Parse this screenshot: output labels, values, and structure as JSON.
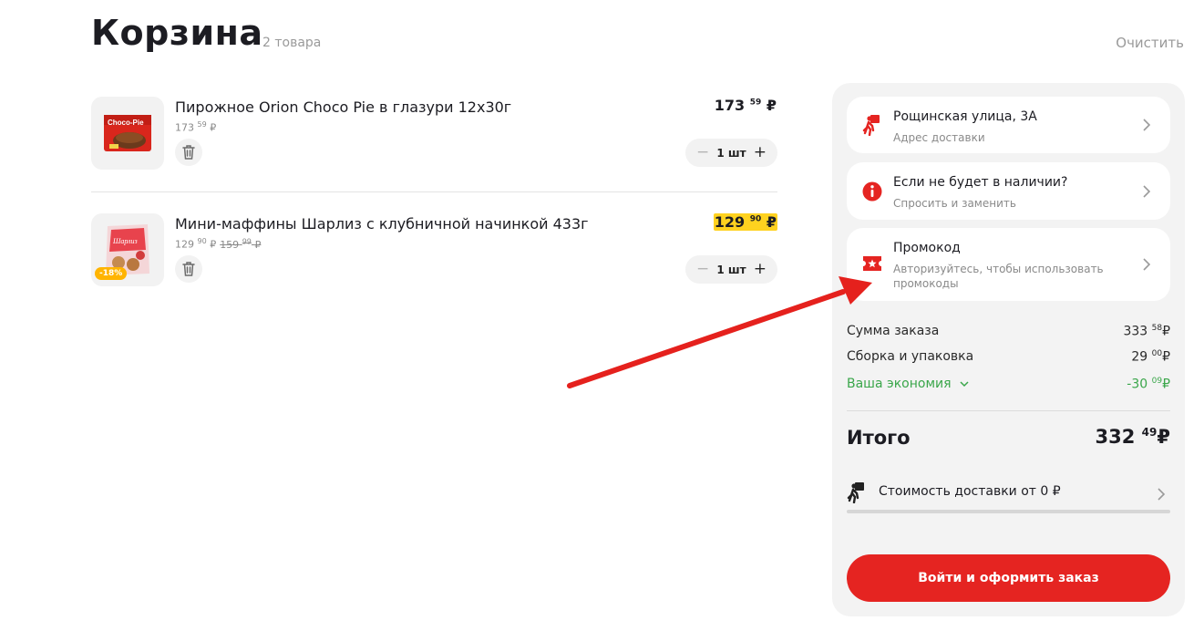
{
  "header": {
    "title": "Корзина",
    "count": "2 товара",
    "clear_label": "Очистить"
  },
  "cart": {
    "items": [
      {
        "name": "Пирожное Orion Choco Pie в глазури 12х30г",
        "unit_price_int": "173",
        "unit_price_frac": "59",
        "unit_currency": "₽",
        "price_int": "173",
        "price_frac": "59",
        "currency": "₽",
        "quantity": "1 шт",
        "minus": "−",
        "plus": "+",
        "thumb_label": "Choco-Pie"
      },
      {
        "name": "Мини-маффины Шарлиз с клубничной начинкой 433г",
        "unit_price_int": "129",
        "unit_price_frac": "90",
        "unit_currency": "₽",
        "old_price_int": "159",
        "old_price_frac": "99",
        "old_currency": "₽",
        "price_int": "129",
        "price_frac": "90",
        "currency": "₽",
        "quantity": "1 шт",
        "minus": "−",
        "plus": "+",
        "discount": "-18%",
        "thumb_label": "Шарлиз"
      }
    ]
  },
  "panel": {
    "address": {
      "title": "Рощинская улица, 3А",
      "subtitle": "Адрес доставки"
    },
    "stock": {
      "title": "Если не будет в наличии?",
      "subtitle": "Спросить и заменить"
    },
    "promo": {
      "title": "Промокод",
      "subtitle": "Авторизуйтесь, чтобы использовать промокоды"
    },
    "summary": {
      "order_sum_label": "Сумма заказа",
      "order_sum_int": "333",
      "order_sum_frac": "58",
      "order_sum_cur": "₽",
      "packing_label": "Сборка и упаковка",
      "packing_int": "29",
      "packing_frac": "00",
      "packing_cur": "₽",
      "savings_label": "Ваша экономия",
      "savings_int": "-30",
      "savings_frac": "09",
      "savings_cur": "₽"
    },
    "total": {
      "label": "Итого",
      "int": "332",
      "frac": "49",
      "cur": "₽"
    },
    "delivery": {
      "label": "Стоимость доставки от 0 ₽"
    },
    "checkout_label": "Войти и оформить заказ"
  },
  "colors": {
    "accent_red": "#e52421",
    "promo_yellow": "#ffd21f",
    "savings_green": "#3aa64a",
    "discount_badge": "#ffb400"
  },
  "icons": {
    "address": "courier-icon",
    "stock": "info-icon",
    "promo": "ticket-icon",
    "delivery": "courier-walk-icon",
    "chevron": "chevron-right-icon",
    "trash": "trash-icon"
  }
}
